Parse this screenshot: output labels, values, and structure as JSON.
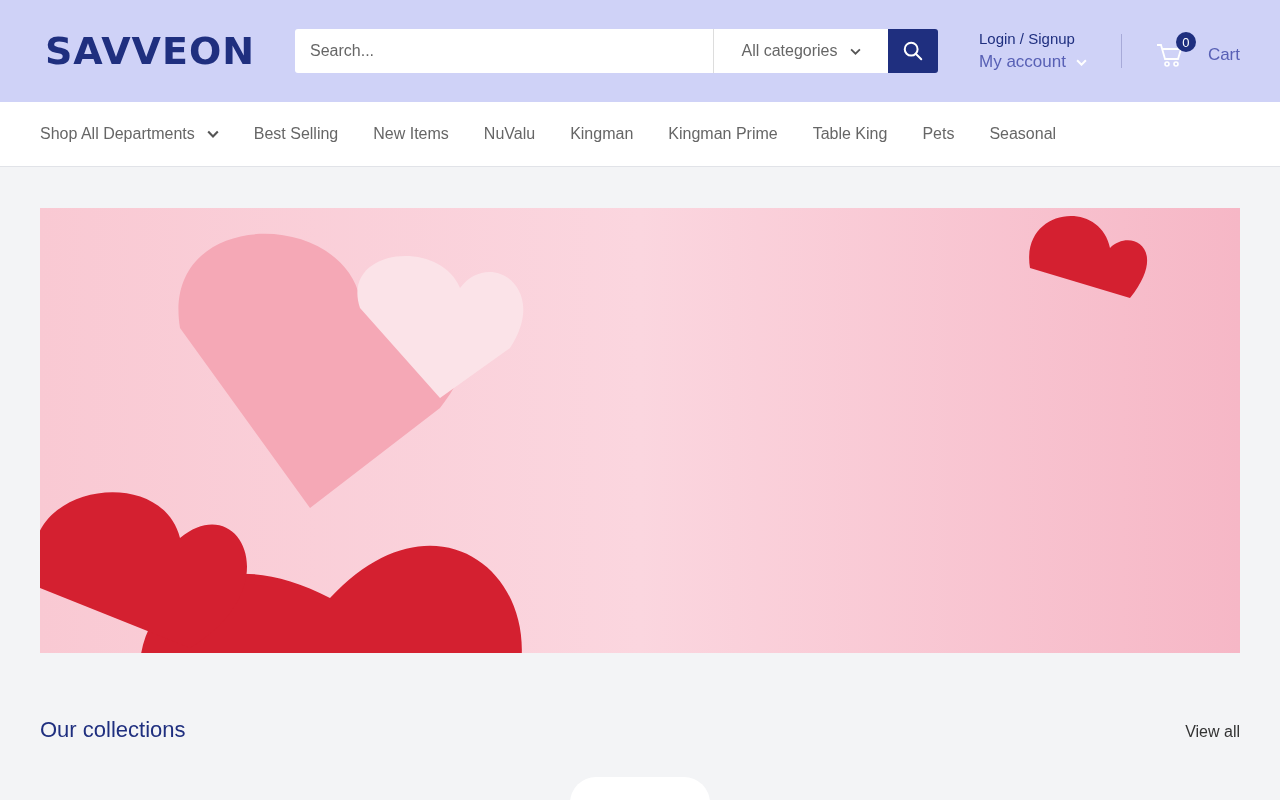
{
  "header": {
    "logo": "SAVVEON",
    "search": {
      "placeholder": "Search...",
      "category": "All categories"
    },
    "account": {
      "login": "Login / Signup",
      "label": "My account"
    },
    "cart": {
      "count": "0",
      "label": "Cart"
    }
  },
  "nav": [
    {
      "label": "Shop All Departments",
      "dropdown": true
    },
    {
      "label": "Best Selling",
      "dropdown": false
    },
    {
      "label": "New Items",
      "dropdown": false
    },
    {
      "label": "NuValu",
      "dropdown": false
    },
    {
      "label": "Kingman",
      "dropdown": false
    },
    {
      "label": "Kingman Prime",
      "dropdown": false
    },
    {
      "label": "Table King",
      "dropdown": false
    },
    {
      "label": "Pets",
      "dropdown": false
    },
    {
      "label": "Seasonal",
      "dropdown": false
    }
  ],
  "collections": {
    "title": "Our collections",
    "link": "View all"
  }
}
